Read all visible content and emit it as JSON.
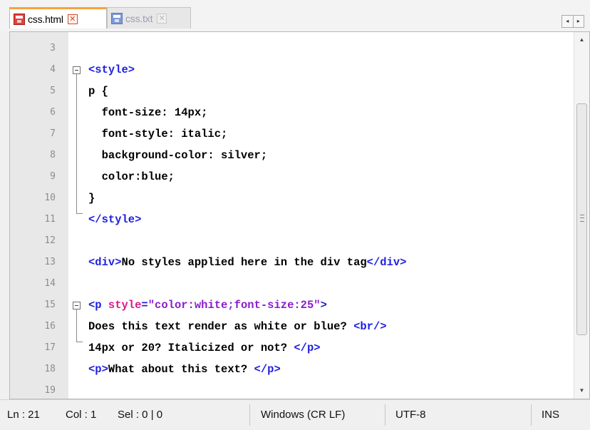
{
  "tabs": [
    {
      "label": "css.html",
      "active": true,
      "icon": "save-red-icon"
    },
    {
      "label": "css.txt",
      "active": false,
      "icon": "save-blue-icon"
    }
  ],
  "tab_scroll": {
    "left": "◂",
    "right": "▸"
  },
  "editor": {
    "lines": [
      {
        "no": "3"
      },
      {
        "no": "4"
      },
      {
        "no": "5"
      },
      {
        "no": "6"
      },
      {
        "no": "7"
      },
      {
        "no": "8"
      },
      {
        "no": "9"
      },
      {
        "no": "10"
      },
      {
        "no": "11"
      },
      {
        "no": "12"
      },
      {
        "no": "13"
      },
      {
        "no": "14"
      },
      {
        "no": "15"
      },
      {
        "no": "16"
      },
      {
        "no": "17"
      },
      {
        "no": "18"
      },
      {
        "no": "19"
      }
    ],
    "code": {
      "l4_tag": "<style>",
      "l5_text": "p {",
      "l6_text": "  font-size: 14px;",
      "l7_text": "  font-style: italic;",
      "l8_text": "  background-color: silver;",
      "l9_text": "  color:blue;",
      "l10_text": "}",
      "l11_tag": "</style>",
      "l13_open": "<div>",
      "l13_text": "No styles applied here in the div tag",
      "l13_close": "</div>",
      "l15_open": "<p ",
      "l15_attr": "style",
      "l15_eq": "=",
      "l15_str": "\"color:white;font-size:25\"",
      "l15_close": ">",
      "l16_text": "Does this text render as white or blue? ",
      "l16_tag": "<br/>",
      "l17_text": "14px or 20? Italicized or not? ",
      "l17_tag": "</p>",
      "l18_open": "<p>",
      "l18_text": "What about this text? ",
      "l18_close": "</p>"
    }
  },
  "scrollbar": {
    "up": "▲",
    "down": "▼"
  },
  "status": {
    "ln": "Ln : 21",
    "col": "Col : 1",
    "sel": "Sel : 0 | 0",
    "eol": "Windows (CR LF)",
    "encoding": "UTF-8",
    "mode": "INS"
  },
  "colors": {
    "tag": "#1f1fe0",
    "attribute": "#e0178c",
    "string": "#8a1ecc",
    "active_tab_accent": "#f7a33d"
  }
}
